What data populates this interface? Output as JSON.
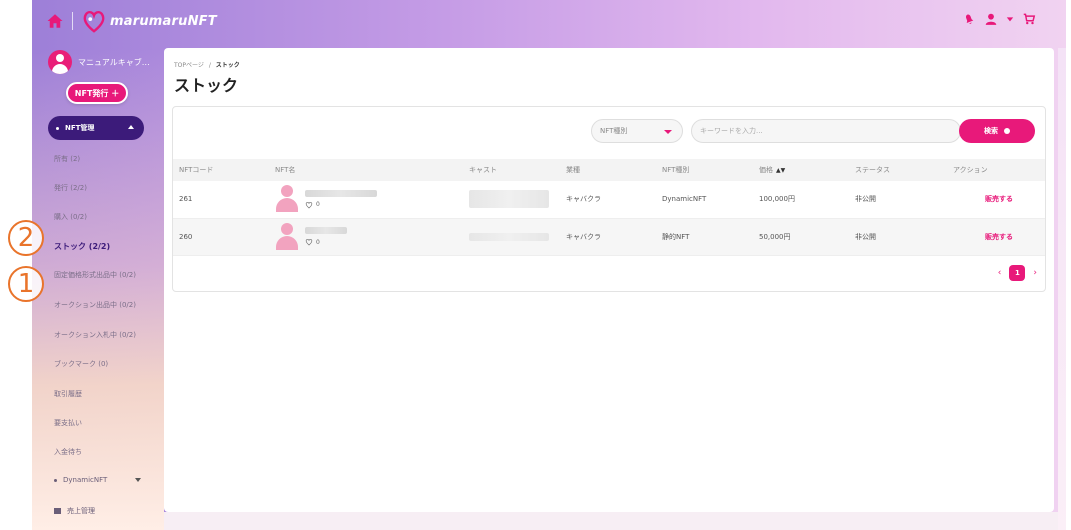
{
  "header": {
    "logo_text": "marumaruNFT"
  },
  "sidebar": {
    "user_name": "マニュアルキャブ…",
    "issue_button": "NFT発行 ＋",
    "section_label": "NFT管理",
    "items": [
      {
        "label": "所有 (2)"
      },
      {
        "label": "発行 (2/2)"
      },
      {
        "label": "購入 (0/2)"
      },
      {
        "label": "ストック (2/2)"
      },
      {
        "label": "固定価格形式出品中 (0/2)"
      },
      {
        "label": "オークション出品中 (0/2)"
      },
      {
        "label": "オークション入札中 (0/2)"
      },
      {
        "label": "ブックマーク (0)"
      },
      {
        "label": "取引履歴"
      },
      {
        "label": "要支払い"
      },
      {
        "label": "入金待ち"
      }
    ],
    "dynamic_label": "DynamicNFT",
    "sales_label": "売上管理"
  },
  "annotations": {
    "first": "2",
    "second": "1"
  },
  "main": {
    "breadcrumb_top": "TOPページ",
    "breadcrumb_sep": "/",
    "breadcrumb_current": "ストック",
    "title": "ストック",
    "filter_select": "NFT種別",
    "search_placeholder": "キーワードを入力...",
    "search_button": "検索",
    "columns": [
      "NFTコード",
      "NFT名",
      "キャスト",
      "業種",
      "NFT種別",
      "価格",
      "ステータス",
      "アクション"
    ],
    "rows": [
      {
        "code": "261",
        "likes": "0",
        "industry": "キャバクラ",
        "type": "DynamicNFT",
        "price": "100,000円",
        "status": "非公開",
        "action": "販売する"
      },
      {
        "code": "260",
        "likes": "0",
        "industry": "キャバクラ",
        "type": "静的NFT",
        "price": "50,000円",
        "status": "非公開",
        "action": "販売する"
      }
    ],
    "pagination": {
      "prev": "‹",
      "current": "1",
      "next": "›"
    }
  },
  "colors": {
    "accent": "#e8197a",
    "nav_dark": "#3c1b7a",
    "annotation": "#e9742b"
  }
}
